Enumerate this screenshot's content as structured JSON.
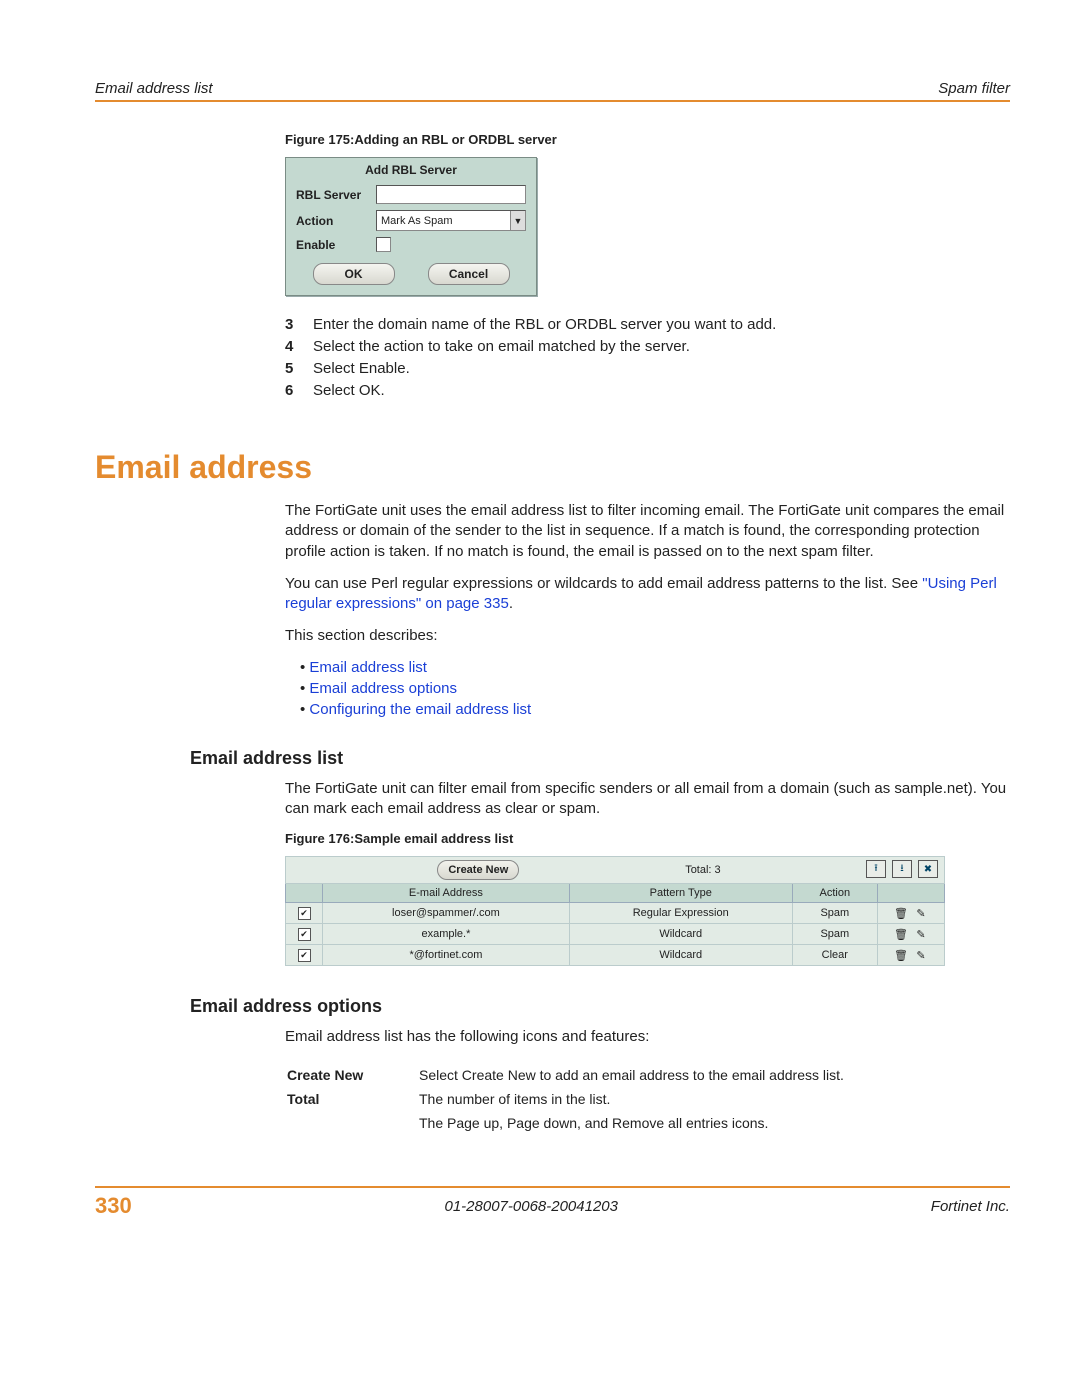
{
  "header": {
    "left": "Email address list",
    "right": "Spam filter"
  },
  "figure175": {
    "caption": "Figure 175:Adding an RBL or ORDBL server",
    "title": "Add RBL Server",
    "rows": {
      "server_label": "RBL Server",
      "action_label": "Action",
      "action_value": "Mark As Spam",
      "enable_label": "Enable"
    },
    "ok": "OK",
    "cancel": "Cancel"
  },
  "steps": [
    {
      "n": "3",
      "t": "Enter the domain name of the RBL or ORDBL server you want to add."
    },
    {
      "n": "4",
      "t": "Select the action to take on email matched by the server."
    },
    {
      "n": "5",
      "t": "Select Enable."
    },
    {
      "n": "6",
      "t": "Select OK."
    }
  ],
  "h1": "Email address",
  "para1": "The FortiGate unit uses the email address list to filter incoming email. The FortiGate unit compares the email address or domain of the sender to the list in sequence. If a match is found, the corresponding protection profile action is taken. If no match is found, the email is passed on to the next spam filter.",
  "para2a": "You can use Perl regular expressions or wildcards to add email address patterns to the list. See ",
  "para2link": "\"Using Perl regular expressions\" on page 335",
  "para2b": ".",
  "para3": "This section describes:",
  "bullets": [
    "Email address list",
    "Email address options",
    "Configuring the email address list"
  ],
  "h2a": "Email address list",
  "para4": "The FortiGate unit can filter email from specific senders or all email from a domain (such as sample.net). You can mark each email address as clear or spam.",
  "figure176": {
    "caption": "Figure 176:Sample email address list",
    "create": "Create New",
    "total": "Total: 3",
    "columns": [
      "",
      "E-mail Address",
      "Pattern Type",
      "Action",
      ""
    ],
    "rows": [
      {
        "chk": true,
        "email": "loser@spammer/.com",
        "type": "Regular Expression",
        "action": "Spam"
      },
      {
        "chk": true,
        "email": "example.*",
        "type": "Wildcard",
        "action": "Spam"
      },
      {
        "chk": true,
        "email": "*@fortinet.com",
        "type": "Wildcard",
        "action": "Clear"
      }
    ]
  },
  "h2b": "Email address options",
  "para5": "Email address list has the following icons and features:",
  "options": [
    {
      "k": "Create New",
      "v": "Select Create New to add an email address to the email address list."
    },
    {
      "k": "Total",
      "v": "The number of items in the list."
    },
    {
      "k": "",
      "v": "The Page up, Page down, and Remove all entries icons."
    }
  ],
  "footer": {
    "page": "330",
    "docid": "01-28007-0068-20041203",
    "company": "Fortinet Inc."
  }
}
